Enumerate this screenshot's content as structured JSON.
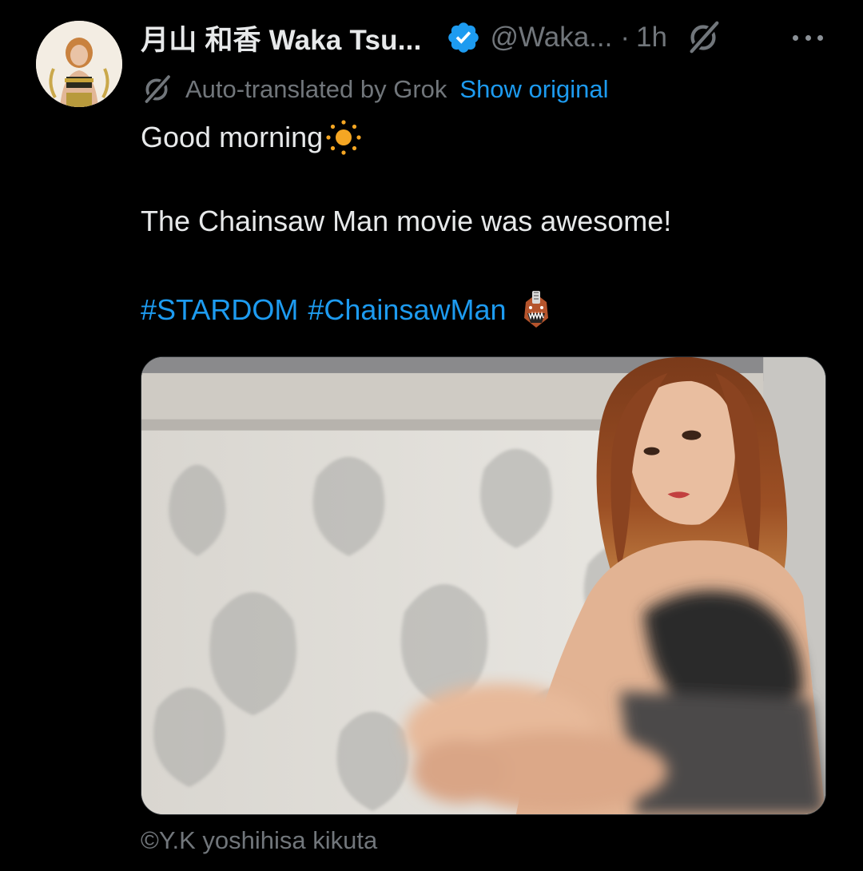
{
  "author": {
    "display_name": "月山 和香 Waka Tsu...",
    "handle": "@Waka...",
    "dot": "·",
    "time": "1h",
    "verified": true
  },
  "translation": {
    "label": "Auto-translated by Grok",
    "show_original": "Show original"
  },
  "post": {
    "line1": "Good morning",
    "line2": "The Chainsaw Man movie was awesome!",
    "hashtags": [
      "#STARDOM",
      "#ChainsawMan"
    ]
  },
  "media": {
    "credit": "©Y.K yoshihisa kikuta"
  },
  "icons": {
    "avatar": "avatar",
    "verified": "verified-badge-icon",
    "grok": "grok-icon",
    "more": "more-icon",
    "sun": "sun-emoji",
    "chainsaw": "chainsaw-man-emoji"
  },
  "colors": {
    "background": "#000000",
    "text": "#e7e9ea",
    "muted": "#71767b",
    "accent": "#1d9bf0"
  }
}
